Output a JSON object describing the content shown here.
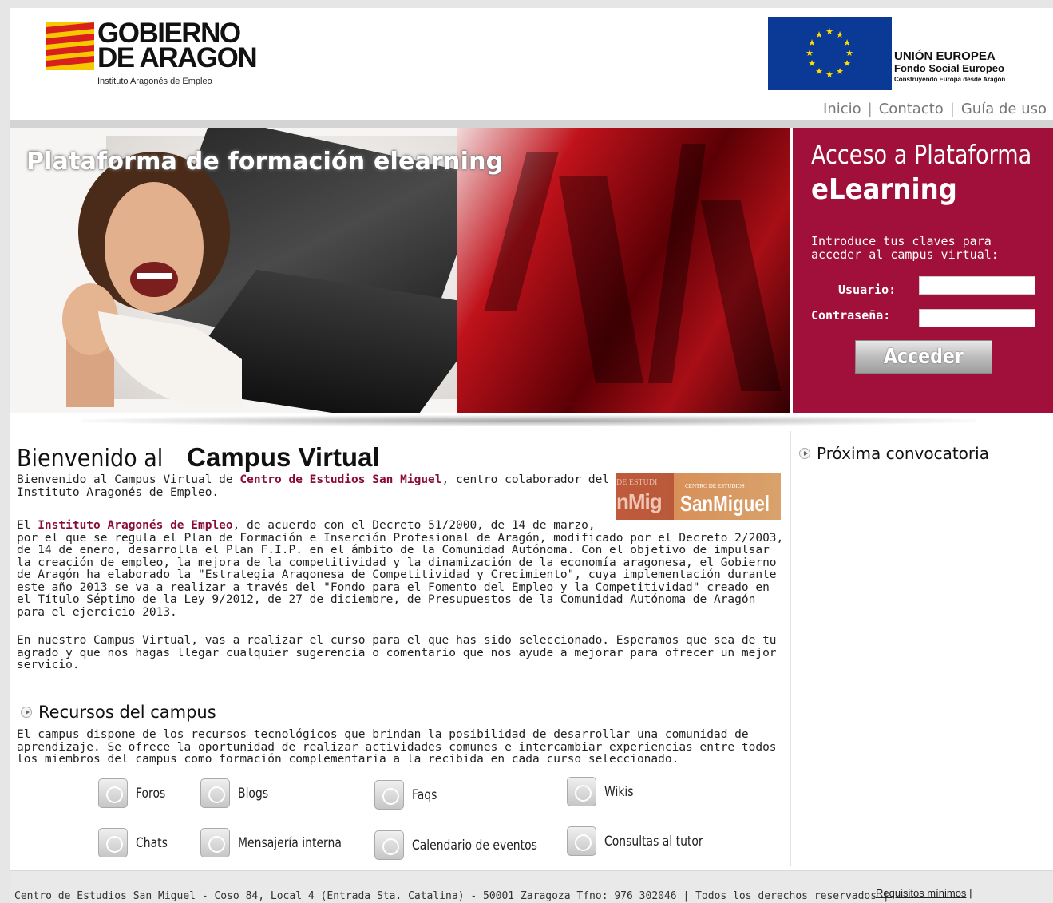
{
  "header": {
    "logo_line1": "GOBIERNO",
    "logo_line2": "DE ARAGON",
    "logo_sub": "Instituto Aragonés de Empleo",
    "eu_line1": "UNIÓN EUROPEA",
    "eu_line2": "Fondo Social Europeo",
    "eu_line3": "Construyendo Europa desde Aragón",
    "nav": [
      "Inicio",
      "Contacto",
      "Guía de uso"
    ],
    "nav_sep": "|"
  },
  "banner": {
    "title": "Plataforma de formación elearning"
  },
  "login": {
    "title_line1": "Acceso a Plataforma",
    "title_line2": "eLearning",
    "intro": "Introduce tus claves para acceder al campus virtual:",
    "user_label": "Usuario:",
    "password_label": "Contraseña:",
    "user_value": "",
    "password_value": "",
    "button": "Acceder"
  },
  "main": {
    "welcome_prefix": "Bienvenido al",
    "welcome_strong": "Campus Virtual",
    "p1_a": "Bienvenido al Campus Virtual de ",
    "p1_link": "Centro de Estudios San Miguel",
    "p1_b": ", centro colaborador del Instituto Aragonés de Empleo.",
    "p2_a": "El ",
    "p2_link": "Instituto Aragonés de Empleo",
    "p2_b": ", de acuerdo con el Decreto 51/2000, de 14 de marzo,",
    "p2_c": "por el que se regula el Plan de Formación e Inserción Profesional de Aragón, modificado por el Decreto 2/2003, de 14 de enero, desarrolla el Plan F.I.P. en el ámbito de la Comunidad Autónoma. Con el objetivo de impulsar la creación de empleo, la mejora de la competitividad y la dinamización de la economía aragonesa, el Gobierno de Aragón ha elaborado la \"Estrategia Aragonesa de Competitividad y Crecimiento\", cuya implementación durante este año 2013 se va a realizar a través del \"Fondo para el Fomento del Empleo y la Competitividad\" creado en el Título Séptimo de la Ley 9/2012, de 27 de diciembre, de Presupuestos de la Comunidad Autónoma de Aragón para el ejercicio 2013.",
    "p3": "En nuestro Campus Virtual, vas a realizar el curso para el que has sido seleccionado. Esperamos que sea de tu agrado y que nos hagas llegar cualquier sugerencia o comentario que nos ayude a mejorar para ofrecer un mejor servicio.",
    "logo_left_top": "DE ESTUDI",
    "logo_left_big": "nMig",
    "logo_right_top": "CENTRO DE ESTUDIOS",
    "logo_right_big": "SanMiguel",
    "recursos_title": "Recursos del campus",
    "recursos_text": "El campus dispone de los recursos tecnológicos que brindan la posibilidad de desarrollar una comunidad de aprendizaje. Se ofrece la oportunidad de realizar actividades comunes e intercambiar experiencias entre todos los miembros del campus como formación complementaria a la recibida en cada curso seleccionado.",
    "resources": [
      "Foros",
      "Blogs",
      "Faqs",
      "Wikis",
      "Chats",
      "Mensajería interna",
      "Calendario de eventos",
      "Consultas al tutor"
    ]
  },
  "side": {
    "title": "Próxima convocatoria"
  },
  "footer": {
    "text": "Centro de Estudios San Miguel - Coso 84, Local 4 (Entrada Sta. Catalina) - 50001 Zaragoza Tfno: 976 302046 | Todos los derechos reservados |",
    "requisitos": "Requisitos mínimos",
    "req_sep": "|"
  }
}
